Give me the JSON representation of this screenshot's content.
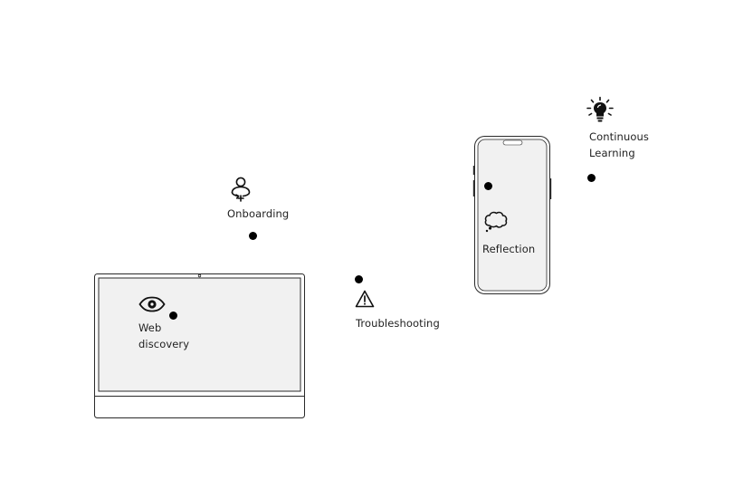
{
  "steps": {
    "web_discovery": {
      "line1": "Web",
      "line2": "discovery",
      "icon": "eye-icon"
    },
    "onboarding": {
      "label": "Onboarding",
      "icon": "user-refresh-icon"
    },
    "troubleshooting": {
      "label": "Troubleshooting",
      "icon": "warning-icon"
    },
    "reflection": {
      "label": "Reflection",
      "icon": "thought-cloud-icon"
    },
    "continuous_learning": {
      "line1": "Continuous",
      "line2": "Learning",
      "icon": "lightbulb-icon"
    }
  },
  "colors": {
    "screen_fill": "#f1f1f1",
    "outline": "#2a2a2a",
    "dot": "#000000",
    "text": "#1f1f1f"
  }
}
